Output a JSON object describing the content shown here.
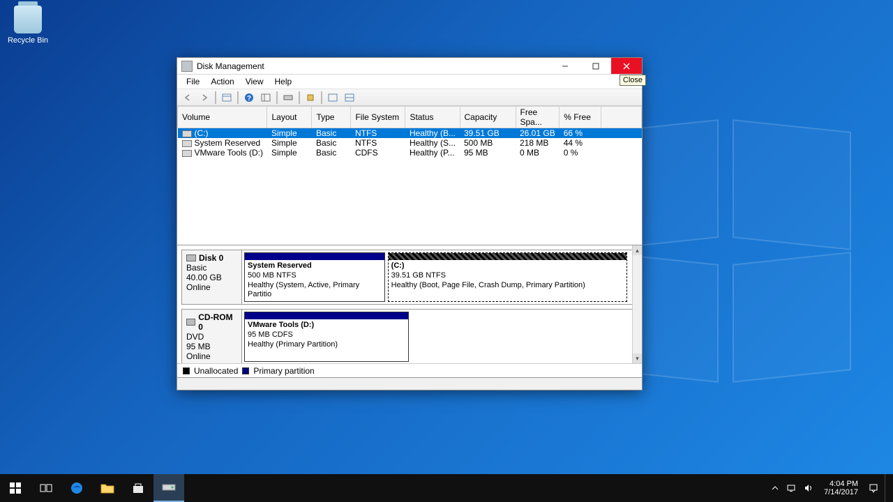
{
  "desktop": {
    "recycle_bin": "Recycle Bin"
  },
  "window": {
    "title": "Disk Management",
    "close_tooltip": "Close",
    "menu": [
      "File",
      "Action",
      "View",
      "Help"
    ],
    "columns": [
      "Volume",
      "Layout",
      "Type",
      "File System",
      "Status",
      "Capacity",
      "Free Spa...",
      "% Free"
    ],
    "volumes": [
      {
        "name": "(C:)",
        "layout": "Simple",
        "type": "Basic",
        "fs": "NTFS",
        "status": "Healthy (B...",
        "capacity": "39.51 GB",
        "free": "26.01 GB",
        "pct": "66 %",
        "selected": true
      },
      {
        "name": "System Reserved",
        "layout": "Simple",
        "type": "Basic",
        "fs": "NTFS",
        "status": "Healthy (S...",
        "capacity": "500 MB",
        "free": "218 MB",
        "pct": "44 %",
        "selected": false
      },
      {
        "name": "VMware Tools (D:)",
        "layout": "Simple",
        "type": "Basic",
        "fs": "CDFS",
        "status": "Healthy (P...",
        "capacity": "95 MB",
        "free": "0 MB",
        "pct": "0 %",
        "selected": false
      }
    ],
    "disks": [
      {
        "label": "Disk 0",
        "sub1": "Basic",
        "sub2": "40.00 GB",
        "sub3": "Online",
        "parts": [
          {
            "title": "System Reserved",
            "line2": "500 MB NTFS",
            "line3": "Healthy (System, Active, Primary Partitio",
            "widthPct": 37,
            "selected": false
          },
          {
            "title": "(C:)",
            "line2": "39.51 GB NTFS",
            "line3": "Healthy (Boot, Page File, Crash Dump, Primary Partition)",
            "widthPct": 63,
            "selected": true
          }
        ]
      },
      {
        "label": "CD-ROM 0",
        "sub1": "DVD",
        "sub2": "95 MB",
        "sub3": "Online",
        "parts": [
          {
            "title": "VMware Tools  (D:)",
            "line2": "95 MB CDFS",
            "line3": "Healthy (Primary Partition)",
            "widthPct": 43,
            "selected": false
          }
        ]
      }
    ],
    "legend": {
      "unallocated": "Unallocated",
      "primary": "Primary partition"
    }
  },
  "taskbar": {
    "time": "4:04 PM",
    "date": "7/14/2017"
  }
}
